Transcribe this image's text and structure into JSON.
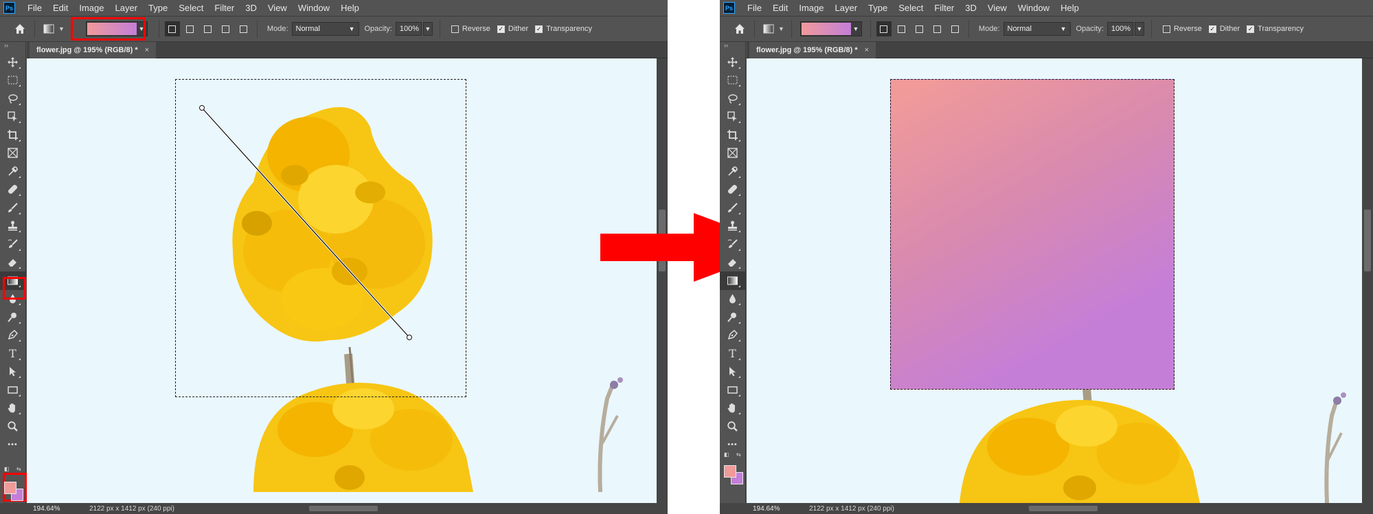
{
  "menu": [
    "File",
    "Edit",
    "Image",
    "Layer",
    "Type",
    "Select",
    "Filter",
    "3D",
    "View",
    "Window",
    "Help"
  ],
  "app_logo": "Ps",
  "options": {
    "mode_label": "Mode:",
    "mode_value": "Normal",
    "opacity_label": "Opacity:",
    "opacity_value": "100%",
    "reverse_label": "Reverse",
    "reverse_checked": false,
    "dither_label": "Dither",
    "dither_checked": true,
    "transparency_label": "Transparency",
    "transparency_checked": true,
    "gradient_colors": [
      "#f09a9a",
      "#c47ed8"
    ]
  },
  "document": {
    "tab_title": "flower.jpg @ 195% (RGB/8) *",
    "tab_close": "×"
  },
  "status": {
    "zoom": "194.64%",
    "dimensions": "2122 px x 1412 px (240 ppi)"
  },
  "colors": {
    "foreground": "#f09a9a",
    "background": "#c47ed8",
    "highlight": "#ff0000",
    "arrow": "#ff0000",
    "canvas_bg": "#eaf7fd"
  },
  "tools": [
    "move-icon",
    "marquee-icon",
    "lasso-icon",
    "object-select-icon",
    "crop-icon",
    "frame-icon",
    "eyedropper-icon",
    "healing-icon",
    "brush-icon",
    "stamp-icon",
    "history-brush-icon",
    "eraser-icon",
    "gradient-icon",
    "blur-icon",
    "dodge-icon",
    "pen-icon",
    "type-icon",
    "path-select-icon",
    "rectangle-icon",
    "hand-icon",
    "zoom-icon",
    "more-icon"
  ],
  "text_tool_glyph": "T",
  "more_tool_glyph": "•••",
  "expand_glyph": "››",
  "left_panel": {
    "note": "before"
  },
  "right_panel": {
    "note": "after"
  }
}
